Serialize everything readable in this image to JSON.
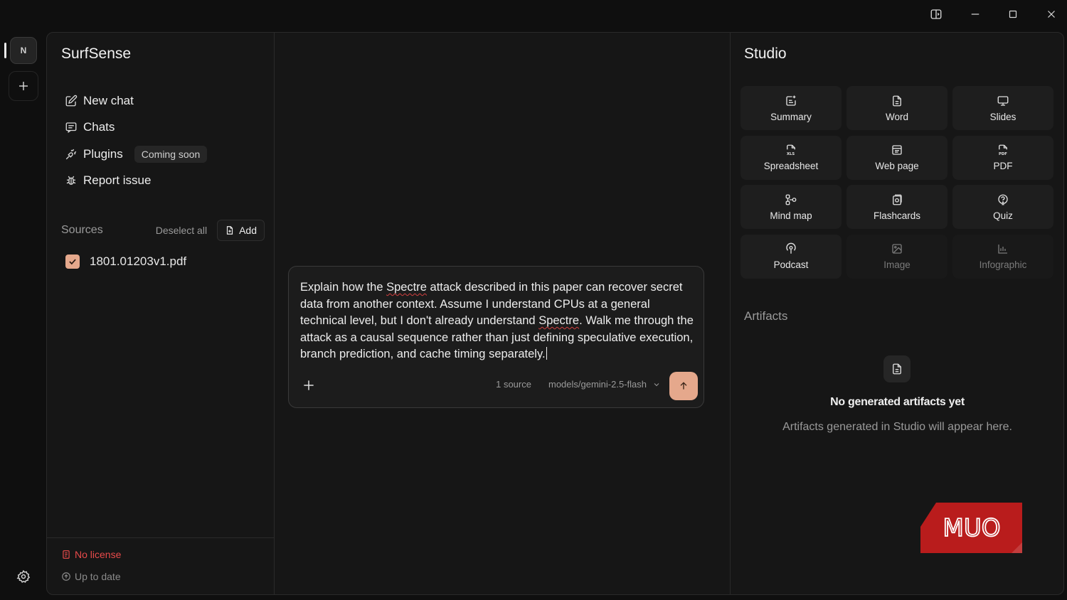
{
  "rail": {
    "avatar_initial": "N"
  },
  "sidebar": {
    "brand": "SurfSense",
    "nav": [
      {
        "label": "New chat",
        "icon": "edit-icon"
      },
      {
        "label": "Chats",
        "icon": "message-icon"
      },
      {
        "label": "Plugins",
        "icon": "plug-icon",
        "badge": "Coming soon"
      },
      {
        "label": "Report issue",
        "icon": "bug-icon"
      }
    ],
    "sources": {
      "title": "Sources",
      "deselect_label": "Deselect all",
      "add_label": "Add",
      "items": [
        {
          "name": "1801.01203v1.pdf",
          "checked": true
        }
      ]
    },
    "footer": {
      "license": "No license",
      "status": "Up to date"
    }
  },
  "composer": {
    "text_parts": [
      "Explain how the ",
      "Spectre",
      " attack described in this paper can recover secret data from another context. Assume I understand CPUs at a general technical level, but I don't already understand ",
      "Spectre",
      ". Walk me through the attack as a causal sequence rather than just defining speculative execution, branch prediction, and cache timing separately."
    ],
    "source_count": "1 source",
    "model": "models/gemini-2.5-flash"
  },
  "studio": {
    "title": "Studio",
    "tiles": [
      {
        "label": "Summary",
        "icon": "summary-icon",
        "enabled": true
      },
      {
        "label": "Word",
        "icon": "document-icon",
        "enabled": true
      },
      {
        "label": "Slides",
        "icon": "presentation-icon",
        "enabled": true
      },
      {
        "label": "Spreadsheet",
        "icon": "spreadsheet-icon",
        "enabled": true
      },
      {
        "label": "Web page",
        "icon": "webpage-icon",
        "enabled": true
      },
      {
        "label": "PDF",
        "icon": "pdf-icon",
        "enabled": true
      },
      {
        "label": "Mind map",
        "icon": "mindmap-icon",
        "enabled": true
      },
      {
        "label": "Flashcards",
        "icon": "flashcards-icon",
        "enabled": true
      },
      {
        "label": "Quiz",
        "icon": "quiz-icon",
        "enabled": true
      },
      {
        "label": "Podcast",
        "icon": "podcast-icon",
        "enabled": true
      },
      {
        "label": "Image",
        "icon": "image-icon",
        "enabled": false
      },
      {
        "label": "Infographic",
        "icon": "chart-icon",
        "enabled": false
      }
    ],
    "artifacts": {
      "title": "Artifacts",
      "empty_title": "No generated artifacts yet",
      "empty_subtitle": "Artifacts generated in Studio will appear here."
    }
  },
  "watermark": {
    "text": "MUO"
  },
  "colors": {
    "accent": "#e5a88c",
    "danger": "#e84a4a",
    "background": "#0f0f0f",
    "panel": "#161616",
    "watermark": "#b91c1c"
  }
}
